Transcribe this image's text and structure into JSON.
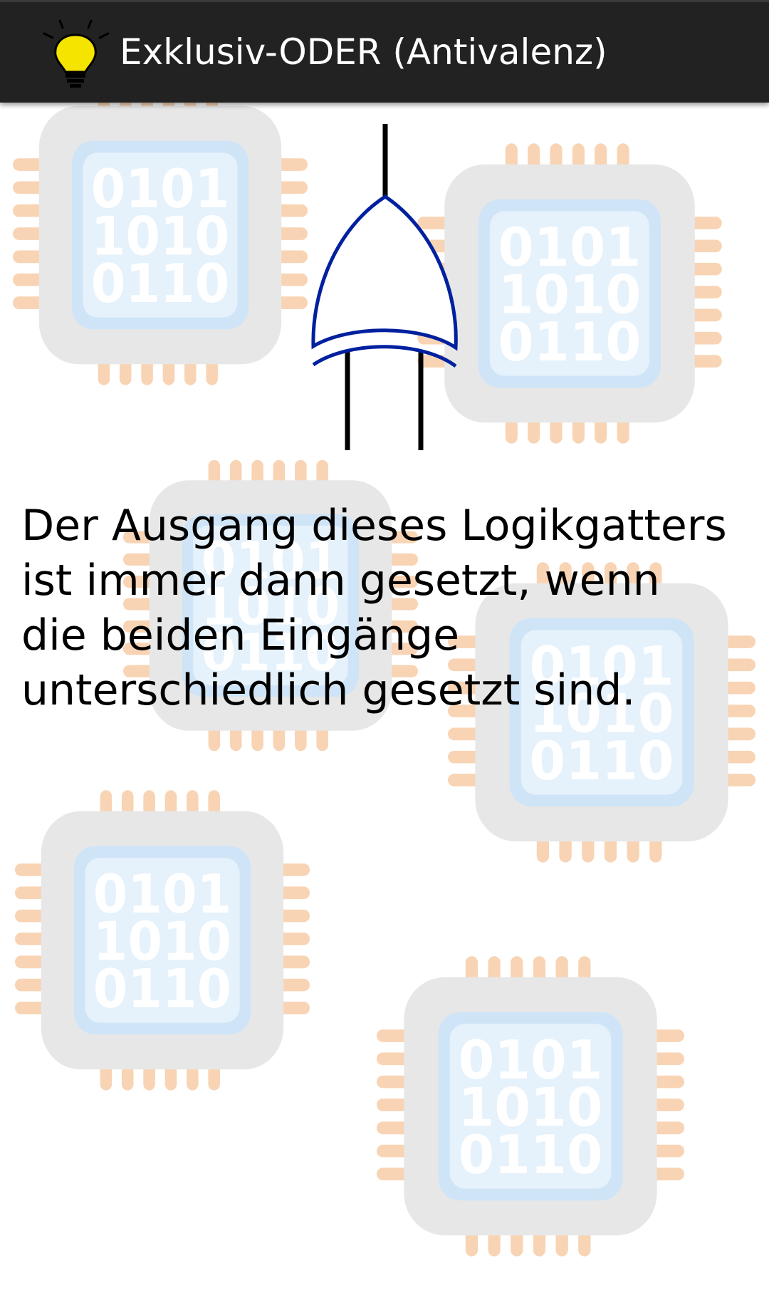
{
  "action_bar": {
    "title": "Exklusiv-ODER (Antivalenz)",
    "icon": "lightbulb-icon",
    "background_color": "#222222"
  },
  "content": {
    "gate_symbol": "xor-gate-icon",
    "description": "Der Ausgang dieses Logikgatters ist immer dann gesetzt, wenn die beiden Eingänge unterschiedlich gesetzt sind.",
    "background_pattern": "microchip-icon",
    "chip_text": [
      "0101",
      "1010",
      "0110"
    ],
    "gate_color": "#00209f"
  }
}
